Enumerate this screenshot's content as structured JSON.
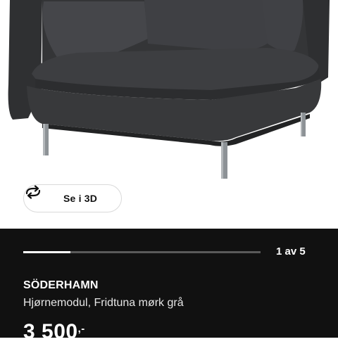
{
  "viewer": {
    "view_3d_label": "Se i 3D",
    "icon": "rotate-3d-icon"
  },
  "gallery": {
    "current_index": 1,
    "total": 5,
    "counter_text": "1 av 5",
    "progress_fraction": 0.2
  },
  "product": {
    "name": "SÖDERHAMN",
    "description": "Hjørnemodul, Fridtuna mørk grå",
    "price_main": "3 500",
    "price_suffix": ",-"
  },
  "colors": {
    "panel_bg": "#111111",
    "sofa": "#3a3b3d"
  }
}
